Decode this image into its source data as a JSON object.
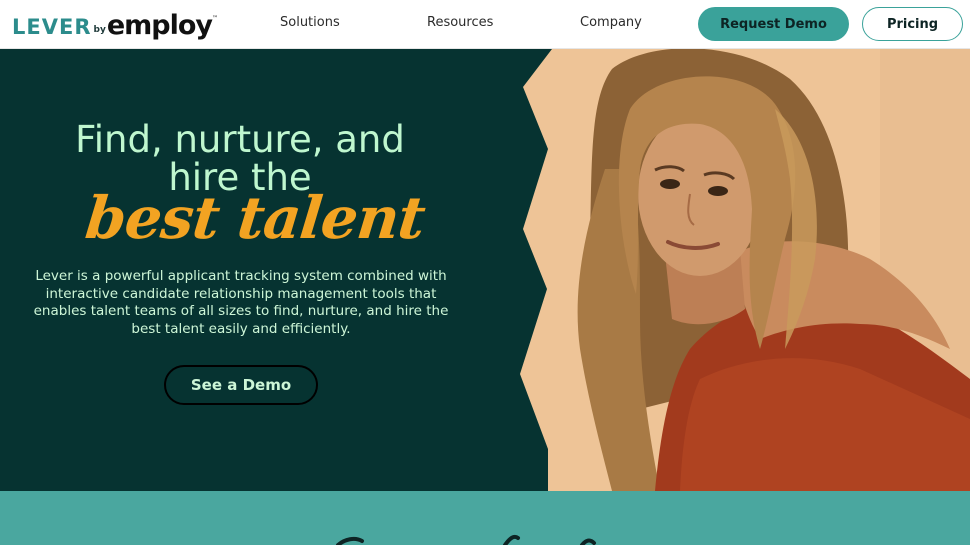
{
  "header": {
    "logo": {
      "brand": "LEVER",
      "by": "by",
      "parent": "employ",
      "tm": "™"
    },
    "nav": [
      "Solutions",
      "Resources",
      "Company"
    ],
    "cta_primary": "Request Demo",
    "cta_secondary": "Pricing"
  },
  "hero": {
    "headline_line1": "Find, nurture, and",
    "headline_line2": "hire the",
    "headline_script": "best talent",
    "body": "Lever is a powerful applicant tracking system combined with interactive candidate relationship management tools that enables talent teams of all sizes to find, nurture, and hire the best talent easily and efficiently.",
    "cta": "See a Demo"
  },
  "colors": {
    "brand_teal": "#3aa29a",
    "hero_bg": "#063331",
    "headline": "#bff7cf",
    "script": "#f2a322",
    "band": "#4aa79f",
    "photo_bg": "#eec497"
  }
}
